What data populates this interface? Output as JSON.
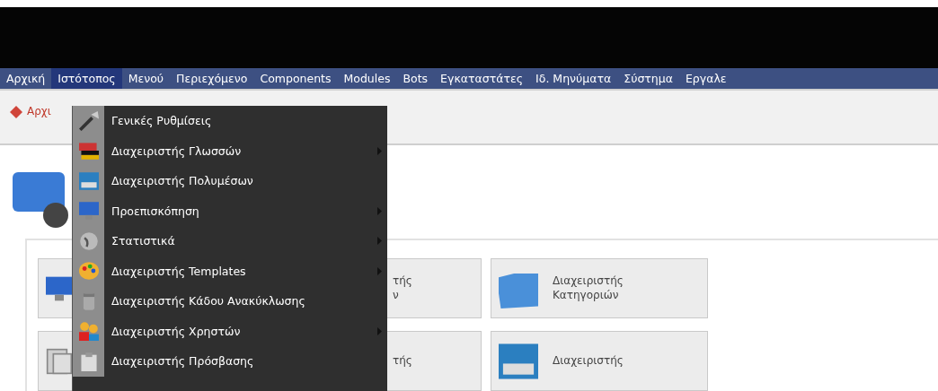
{
  "menubar": [
    {
      "label": "Αρχική",
      "selected": false
    },
    {
      "label": "Ιστότοπος",
      "selected": true
    },
    {
      "label": "Μενού",
      "selected": false
    },
    {
      "label": "Περιεχόμενο",
      "selected": false
    },
    {
      "label": "Components",
      "selected": false
    },
    {
      "label": "Modules",
      "selected": false
    },
    {
      "label": "Bots",
      "selected": false
    },
    {
      "label": "Εγκαταστάτες",
      "selected": false
    },
    {
      "label": "Ιδ. Μηνύματα",
      "selected": false
    },
    {
      "label": "Σύστημα",
      "selected": false
    },
    {
      "label": "Εργαλε",
      "selected": false
    }
  ],
  "breadcrumb": "Αρχι",
  "dropdown": [
    {
      "label": "Γενικές Ρυθμίσεις",
      "submenu": false
    },
    {
      "label": "Διαχειριστής Γλωσσών",
      "submenu": true
    },
    {
      "label": "Διαχειριστής Πολυμέσων",
      "submenu": false
    },
    {
      "label": "Προεπισκόπηση",
      "submenu": true
    },
    {
      "label": "Στατιστικά",
      "submenu": true
    },
    {
      "label": "Διαχειριστής Templates",
      "submenu": true
    },
    {
      "label": "Διαχειριστής Κάδου Ανακύκλωσης",
      "submenu": false
    },
    {
      "label": "Διαχειριστής Χρηστών",
      "submenu": true
    },
    {
      "label": "Διαχειριστής Πρόσβασης",
      "submenu": false
    }
  ],
  "cards": [
    {
      "lines": [
        "τής",
        "ν"
      ]
    },
    {
      "lines": [
        "Διαχειριστής",
        "Κατηγοριών"
      ]
    },
    {
      "lines": [
        "τής"
      ]
    },
    {
      "lines": [
        "Διαχειριστής"
      ]
    }
  ]
}
